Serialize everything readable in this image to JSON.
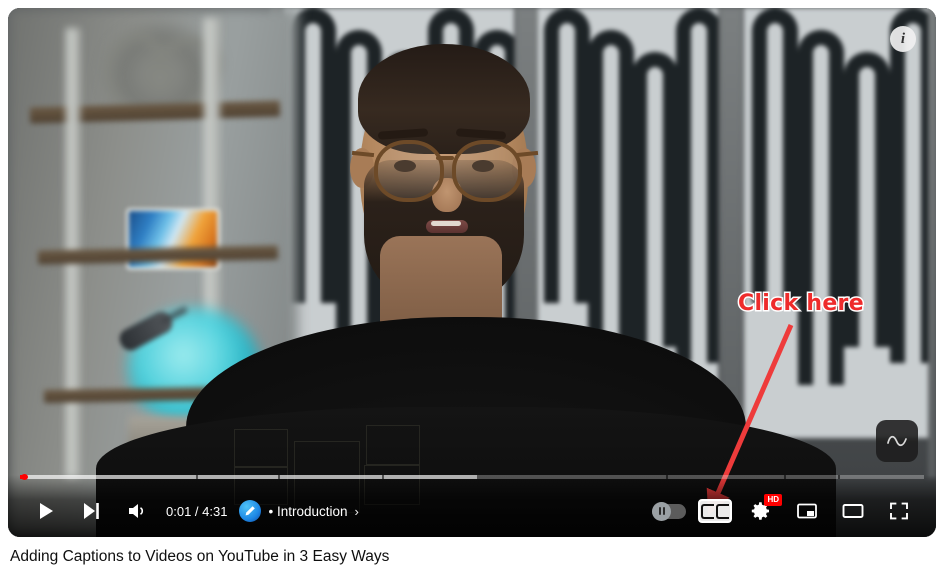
{
  "player": {
    "info_button": {
      "label": "i",
      "icon": "info-icon"
    },
    "stable_volume_button": {
      "icon": "sine-wave-icon",
      "label": ""
    },
    "annotation": {
      "text": "Click here",
      "color": "#ee2b2b",
      "outline_color": "#ffffff",
      "arrow_color": "#ee3b3b"
    },
    "progress": {
      "current_percent": 0.4,
      "buffered_percent": 50.5,
      "chapter_marker_percents": [
        19.5,
        28.5,
        40.0,
        71.5,
        84.5,
        90.5
      ]
    },
    "controls": {
      "play_button": {
        "label": "Play",
        "icon": "play-icon",
        "state": "paused"
      },
      "next_button": {
        "label": "Next",
        "icon": "next-track-icon"
      },
      "volume_button": {
        "label": "Mute",
        "icon": "volume-icon"
      },
      "time": "0:01 / 4:31",
      "current_time": "0:01",
      "duration": "4:31",
      "chapter_bullet": "•",
      "chapter_label": "Introduction",
      "chapter_chevron": "›",
      "channel_avatar": "channel-avatar-icon",
      "autoplay_toggle": {
        "label": "Autoplay",
        "state": "off",
        "icon": "autoplay-toggle-icon"
      },
      "subtitles_button": {
        "label": "CC",
        "icon": "closed-captions-icon",
        "active": true
      },
      "settings_button": {
        "label": "Settings",
        "icon": "gear-icon",
        "badge": "HD"
      },
      "miniplayer_button": {
        "label": "Miniplayer",
        "icon": "miniplayer-icon"
      },
      "theater_button": {
        "label": "Theater mode",
        "icon": "theater-mode-icon"
      },
      "fullscreen_button": {
        "label": "Full screen",
        "icon": "fullscreen-icon"
      }
    }
  },
  "video": {
    "title": "Adding Captions to Videos on YouTube in 3 Easy Ways"
  }
}
